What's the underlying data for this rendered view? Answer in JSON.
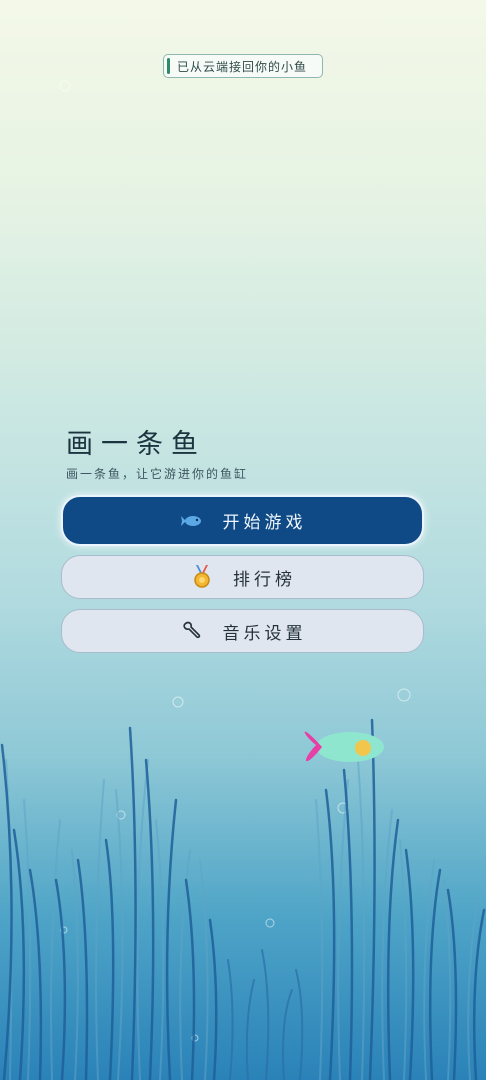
{
  "toast": {
    "message": "已从云端接回你的小鱼"
  },
  "title": "画一条鱼",
  "subtitle": "画一条鱼，让它游进你的鱼缸",
  "buttons": {
    "start": {
      "label": "开始游戏",
      "icon": "fish-icon"
    },
    "leaderboard": {
      "label": "排行榜",
      "icon": "medal-icon"
    },
    "music": {
      "label": "音乐设置",
      "icon": "wrench-icon"
    }
  },
  "colors": {
    "primary_button": "#0f4a86",
    "secondary_button": "#dfe6f0",
    "toast_accent": "#2e8b6a",
    "fish_body": "#8ee6cf",
    "fish_tail": "#e83fa6",
    "fish_eye": "#f2c64a"
  }
}
